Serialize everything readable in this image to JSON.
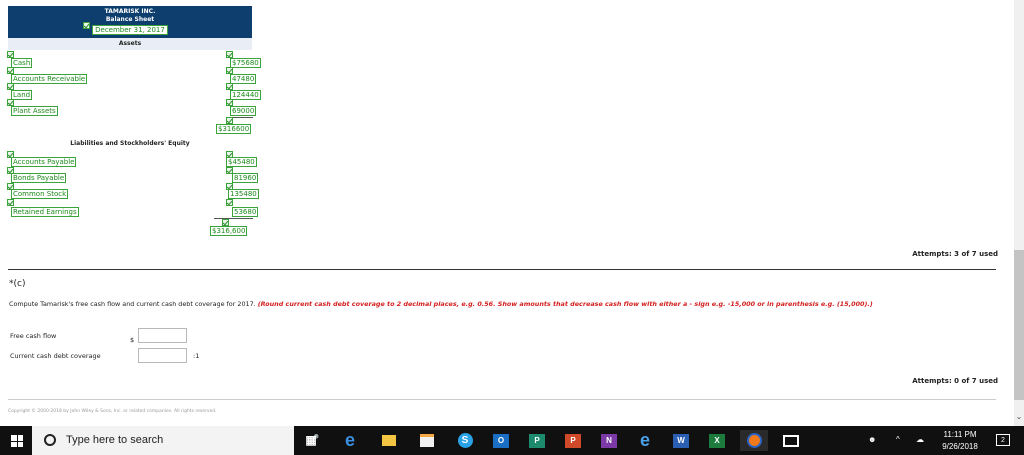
{
  "balance_sheet": {
    "company": "TAMARISK INC.",
    "statement": "Balance Sheet",
    "date": "December 31, 2017",
    "assets_title": "Assets",
    "assets": [
      {
        "label": "Cash",
        "value": "$75680"
      },
      {
        "label": "Accounts Receivable",
        "value": "47480"
      },
      {
        "label": "Land",
        "value": "124440"
      },
      {
        "label": "Plant Assets",
        "value": "69000"
      }
    ],
    "assets_total": "$316600",
    "liabilities_title": "Liabilities and Stockholders' Equity",
    "liabilities": [
      {
        "label": "Accounts Payable",
        "value": "$45480"
      },
      {
        "label": "Bonds Payable",
        "value": "81960"
      },
      {
        "label": "Common Stock",
        "value": "135480"
      },
      {
        "label": "Retained Earnings",
        "value": "53680"
      }
    ],
    "liabilities_total": "$316,600"
  },
  "attempts_b": "Attempts: 3 of 7 used",
  "part_c": {
    "label": "*(c)",
    "instruction": "Compute Tamarisk's free cash flow and current cash debt coverage for 2017.",
    "instruction_note": "(Round current cash debt coverage to 2 decimal places, e.g. 0.56. Show amounts that decrease cash flow with either a - sign e.g. -15,000 or in parenthesis e.g. (15,000).)",
    "free_cash_flow_label": "Free cash flow",
    "free_cash_flow_prefix": "$",
    "free_cash_flow_value": "",
    "coverage_label": "Current cash debt coverage",
    "coverage_value": "",
    "coverage_suffix": ":1",
    "attempts": "Attempts: 0 of 7 used"
  },
  "copyright": "Copyright © 2000-2018 by John Wiley & Sons, Inc. or related companies. All rights reserved.",
  "taskbar": {
    "search_placeholder": "Type here to search",
    "time": "11:11 PM",
    "date": "9/26/2018",
    "notification_count": "2",
    "apps": [
      "task-view",
      "edge",
      "file-explorer",
      "store",
      "skype",
      "outlook",
      "publisher",
      "powerpoint",
      "onenote",
      "internet-explorer",
      "word",
      "excel",
      "firefox",
      "photos"
    ]
  }
}
